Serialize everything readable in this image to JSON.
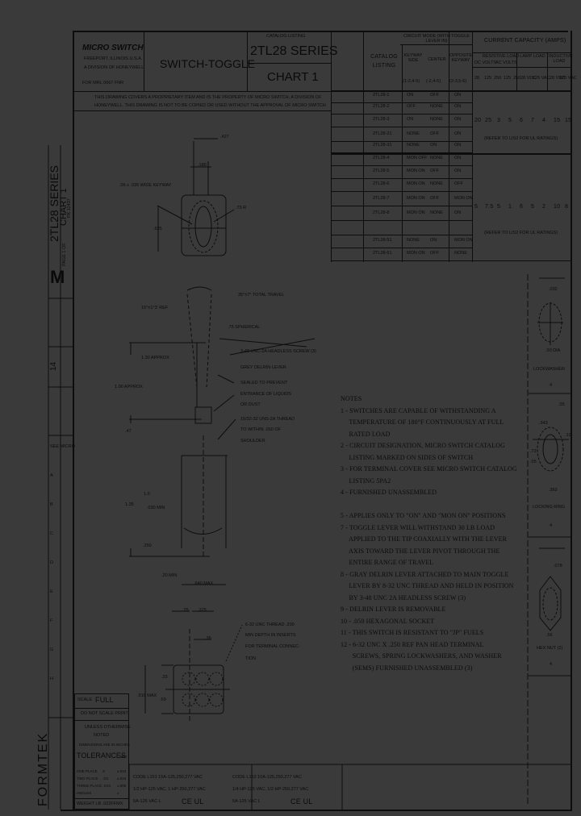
{
  "title_block": {
    "company": "MICRO SWITCH",
    "company_sub1": "FREEPORT, ILLINOIS U.S.A.",
    "company_sub2": "A DIVISION OF HONEYWELL",
    "form": "FOR MRL 0067 FNR",
    "title": "SWITCH-TOGGLE",
    "catalog_label": "CATALOG LISTING",
    "series": "2TL28   SERIES",
    "chart": "CHART 1",
    "proprietary_line1": "THIS DRAWING COVERS A PROPRIETARY ITEM AND IS THE PROPERTY OF MICRO SWITCH, A DIVISION OF",
    "proprietary_line2": "HONEYWELL. THIS DRAWING IS NOT TO BE COPIED OR USED WITHOUT THE APPROVAL OF MICRO SWITCH"
  },
  "catalog_table": {
    "header_catalog": "CATALOG LISTING",
    "header_circuit": "CIRCUIT MODE (WITH TOGGLE LEVER IN)",
    "circuit_cols": [
      "KEYWAY SIDE",
      "CENTER",
      "OPPOSITE KEYWAY"
    ],
    "circuit_terms": [
      "(1-2,4-5)",
      "(-2,4-5)",
      "(2-3,5-6)"
    ],
    "header_current": "CURRENT CAPACITY (AMPS)",
    "current_groups": [
      "RESISTIVE LOAD",
      "LAMP LOAD",
      "INDUCTIVE LOAD"
    ],
    "current_subgroups": [
      "DC VOLTS",
      "AC VOLTS"
    ],
    "voltage_cols": [
      "28",
      "125",
      "250",
      "125",
      "250",
      "28 VDC",
      "125 VAC",
      "28 VDC",
      "125 VAC"
    ],
    "rows": [
      {
        "listing": "2TL28-1",
        "keyway": "ON",
        "center": "OFF",
        "opposite": "ON"
      },
      {
        "listing": "2TL28-2",
        "keyway": "OFF",
        "center": "NONE",
        "opposite": "ON"
      },
      {
        "listing": "2TL28-3",
        "keyway": "ON",
        "center": "NONE",
        "opposite": "ON"
      },
      {
        "listing": "2TL28-21",
        "keyway": "NONE",
        "center": "OFF",
        "opposite": "ON"
      },
      {
        "listing": "2TL28-31",
        "keyway": "NONE",
        "center": "ON",
        "opposite": "ON"
      },
      {
        "listing": "2TL28-4",
        "keyway": "MON OFF",
        "center": "NONE",
        "opposite": "ON"
      },
      {
        "listing": "2TL28-5",
        "keyway": "MON ON",
        "center": "OFF",
        "opposite": "ON"
      },
      {
        "listing": "2TL28-6",
        "keyway": "MON ON",
        "center": "NONE",
        "opposite": "OFF"
      },
      {
        "listing": "2TL28-7",
        "keyway": "MON ON",
        "center": "OFF",
        "opposite": "MON ON"
      },
      {
        "listing": "2TL28-8",
        "keyway": "MON ON",
        "center": "NONE",
        "opposite": "ON"
      },
      {
        "listing": "",
        "keyway": "",
        "center": "",
        "opposite": ""
      },
      {
        "listing": "2TL28-51",
        "keyway": "NONE",
        "center": "ON",
        "opposite": "MON ON"
      },
      {
        "listing": "2TL28-61",
        "keyway": "MON ON",
        "center": "OFF",
        "opposite": "NONE"
      }
    ],
    "ratings_group1": [
      "20",
      "25",
      "3",
      "5",
      "6",
      "7",
      "4",
      "15",
      "15"
    ],
    "ratings_group2": [
      "5",
      "7.5",
      "5",
      "1",
      "6",
      "5",
      "2",
      "10",
      "8"
    ],
    "refer_ul": "(REFER TO LIS2 FOR UL RATINGS)"
  },
  "top_view": {
    "dim_427": ".427",
    "dim_180": ".180",
    "keyway_label": ".06 x .035 WIDE KEYWAY",
    "dim_752": ".75 R",
    "dim_625": ".625"
  },
  "side_view": {
    "total_travel": "35°±7° TOTAL TRAVEL",
    "angle": "15°±1°3' REF",
    "spherical": ".75 SPHERICAL",
    "screw": "3-48 UNC-2A HEADLESS SCREW (3)",
    "lever": "GREY DELRIN LEVER",
    "sealed1": "SEALED TO PREVENT",
    "sealed2": "ENTRANCE OF LIQUIDS",
    "sealed3": "OR DUST",
    "thread1": "15/32-32 UNS-2A THREAD",
    "thread2": "TO WITHIN .050 OF",
    "thread3": "SHOULDER",
    "dim_130": "1.30 APPROX",
    "dim_100": "1.00 APPROX",
    "dim_47": ".47",
    "dim_135": "1.35",
    "dim_10": "1.0",
    "dim_030": ".030 MIN",
    "dim_250": ".250",
    "dim_20min": ".20 MIN",
    "dim_640": ".640 MAX"
  },
  "bottom_view": {
    "dim_25": ".25",
    "dim_375": ".375",
    "dim_35": ".35",
    "thread_note1": "6-32 UNC THREAD .200",
    "thread_note2": "MIN DEPTH IN INSERTS",
    "thread_note3": "FOR TERMINAL CONNEC-",
    "thread_note4": "TION",
    "dim_25b": ".25",
    "dim_910": ".910 MAX",
    "dim_59": ".59"
  },
  "notes": {
    "heading": "NOTES",
    "items": [
      "1 - SWITCHES ARE CAPABLE OF WITHSTANDING A",
      "     TEMPERATURE OF 180°F CONTINUOUSLY AT FULL",
      "     RATED LOAD",
      "2 - CIRCUIT DESIGNATION, MICRO SWITCH CATALOG",
      "     LISTING MARKED ON SIDES OF SWITCH",
      "3 - FOR TERMINAL COVER SEE MICRO SWITCH CATALOG",
      "     LISTING 5PA2",
      "4 - FURNISHED UNASSEMBLED",
      "",
      "5 - APPLIES ONLY TO \"ON\" AND \"MON ON\" POSITIONS",
      "7 - TOGGLE LEVER WILL WITHSTAND 30 LB LOAD",
      "     APPLIED TO THE TIP COAXIALLY WITH THE LEVER",
      "     AXIS TOWARD THE LEVER PIVOT THROUGH THE",
      "     ENTIRE RANGE OF TRAVEL",
      "8 - GRAY DELRIN LEVER ATTACHED TO MAIN TOGGLE",
      "     LEVER BY 8-32 UNC THREAD AND HELD IN POSITION",
      "     BY 3-48 UNC 2A HEADLESS SCREW (3)",
      "9 - DELRIN LEVER IS REMOVABLE",
      "10 - .050 HEXAGONAL SOCKET",
      "11 - THIS SWITCH IS RESISTANT TO \"JP\" FUELS",
      "12 - 6-32 UNC X .250 REF PAN HEAD TERMINAL",
      "       SCREWS, SPRING LOCKWASHERS, AND WASHER",
      "       (SEMS) FURNISHED UNASSEMBLED (3)"
    ]
  },
  "hardware": {
    "washer_dim": ".032",
    "washer_dia": ".50 DIA",
    "lockwasher_label": "LOCKWASHER",
    "ring_dim1": ".05",
    "ring_dim2": ".343",
    "ring_dim3": ".10",
    "ring_dim4": ".72",
    "ring_dim5": ".05",
    "ring_dim6": ".362",
    "locking_ring_label": "LOCKING RING",
    "nut_dim1": ".078",
    "nut_dim2": ".56",
    "hex_nut_label": "HEX NUT (2)",
    "triangle_label": "4"
  },
  "left_strip": {
    "part_number": "2TL28 SERIES",
    "chart": "CHART 1",
    "page": "PAGE 1 OF",
    "dwg": "PK 11437",
    "logo": "M",
    "sheet": "14",
    "company_vertical": "FORMTEK",
    "revisions": [
      "SEE MICRO",
      "A",
      "B",
      "C",
      "D",
      "E",
      "F",
      "G",
      "H"
    ]
  },
  "tolerance_block": {
    "scale_label": "SCALE",
    "scale_value": "FULL",
    "do_not_scale": "DO NOT SCALE PRINT",
    "unless1": "UNLESS OTHERWISE",
    "unless2": "NOTED",
    "dims_in": "DIMENSIONS ARE IN INCHES",
    "tolerances": "TOLERANCES",
    "are": "ARE",
    "rows": [
      {
        "label": "ONE PLACE",
        "x": "X",
        "tol": "±.010"
      },
      {
        "label": "TWO PLACE",
        "x": ".XX",
        "tol": "±.015"
      },
      {
        "label": "THREE PLACE",
        "x": ".XXX",
        "tol": "±.005"
      },
      {
        "label": "ANGLES",
        "x": "",
        "tol": "±"
      }
    ],
    "weight": "WEIGHT  LB  .022FFMX"
  },
  "ratings_block": {
    "left_line1": "CODE L151 15A-125,250,277 VAC",
    "left_line2": "1/2 HP-125 VAC, 1 HP-250,277 VAC",
    "left_line3": "5A-125 VAC  L",
    "right_line1": "CODE L152 10A-125,250,277 VAC",
    "right_line2": "1/4 HP-125 VAC, 1/2 HP-250,277 VAC",
    "right_line3": "5A-125 VAC  L",
    "cert_marks": "CE UL"
  }
}
